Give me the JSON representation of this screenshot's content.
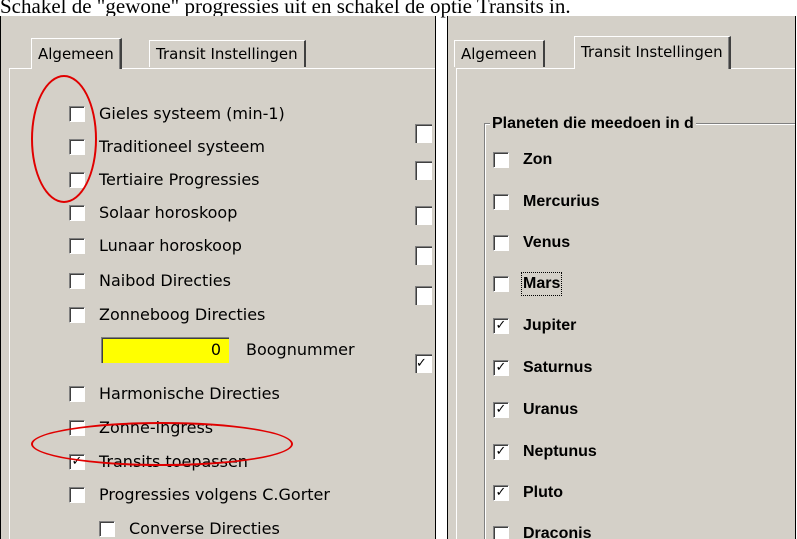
{
  "caption": "Schakel de \"gewone\" progressies uit en schakel de optie Transits in.",
  "left_panel": {
    "tabs": [
      "Algemeen",
      "Transit Instellingen"
    ],
    "options": [
      {
        "label": "Gieles systeem (min-1)",
        "checked": false
      },
      {
        "label": "Traditioneel systeem",
        "checked": false
      },
      {
        "label": "Tertiaire Progressies",
        "checked": false
      },
      {
        "label": "Solaar horoskoop",
        "checked": false
      },
      {
        "label": "Lunaar horoskoop",
        "checked": false
      },
      {
        "label": "Naibod Directies",
        "checked": false
      },
      {
        "label": "Zonneboog Directies",
        "checked": false
      },
      {
        "label": "Harmonische Directies",
        "checked": false
      },
      {
        "label": "Zonne-ingress",
        "checked": false
      },
      {
        "label": "Transits toepassen",
        "checked": true
      },
      {
        "label": "Progressies volgens C.Gorter",
        "checked": false
      },
      {
        "label": "Converse Directies",
        "checked": false
      }
    ],
    "arc_number_value": "0",
    "arc_number_label": "Boognummer",
    "check_mark": "✓"
  },
  "right_panel": {
    "tabs": [
      "Algemeen",
      "Transit Instellingen"
    ],
    "group_title": "Planeten die meedoen in d",
    "planets": [
      {
        "label": "Zon",
        "checked": false
      },
      {
        "label": "Mercurius",
        "checked": false
      },
      {
        "label": "Venus",
        "checked": false
      },
      {
        "label": "Mars",
        "checked": false
      },
      {
        "label": "Jupiter",
        "checked": true
      },
      {
        "label": "Saturnus",
        "checked": true
      },
      {
        "label": "Uranus",
        "checked": true
      },
      {
        "label": "Neptunus",
        "checked": true
      },
      {
        "label": "Pluto",
        "checked": true
      },
      {
        "label": "Draconis",
        "checked": false
      }
    ]
  },
  "colors": {
    "panel_bg": "#d4d0c8",
    "highlight": "#e00000",
    "input_highlight": "#ffff00"
  }
}
